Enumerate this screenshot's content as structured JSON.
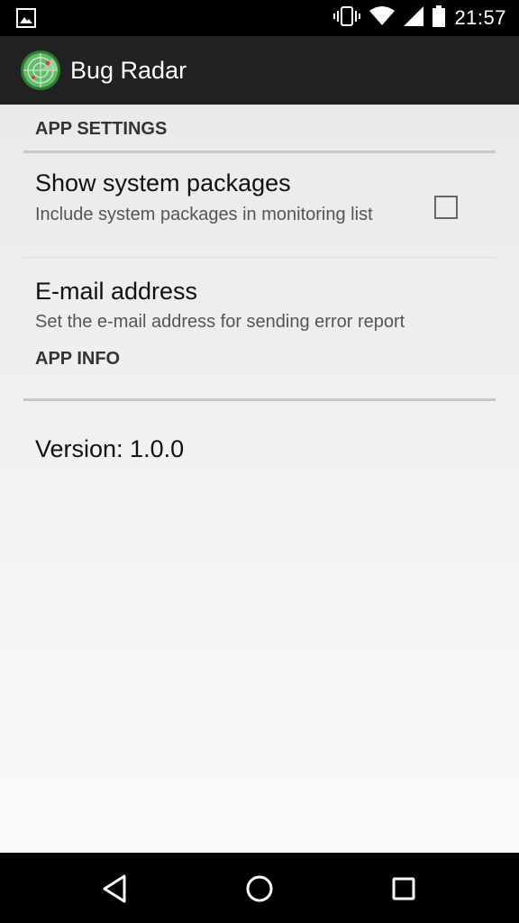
{
  "status_bar": {
    "time": "21:57",
    "icons": [
      "image-notification-icon",
      "vibrate-icon",
      "wifi-icon",
      "signal-icon",
      "battery-icon"
    ]
  },
  "app_bar": {
    "title": "Bug Radar",
    "icon": "radar-app-icon"
  },
  "settings": {
    "app_settings_header": "APP SETTINGS",
    "show_system_packages": {
      "title": "Show system packages",
      "summary": "Include system packages in monitoring list",
      "checked": false
    },
    "email_address": {
      "title": "E-mail address",
      "summary": "Set the e-mail address for sending error report"
    },
    "app_info_header": "APP INFO",
    "version": "Version: 1.0.0"
  },
  "nav_bar": {
    "buttons": [
      "back-icon",
      "home-icon",
      "recents-icon"
    ]
  },
  "colors": {
    "status_bar": "#000000",
    "app_bar": "#212121",
    "background": "#f0f0f0",
    "accent_green": "#4caf50"
  }
}
